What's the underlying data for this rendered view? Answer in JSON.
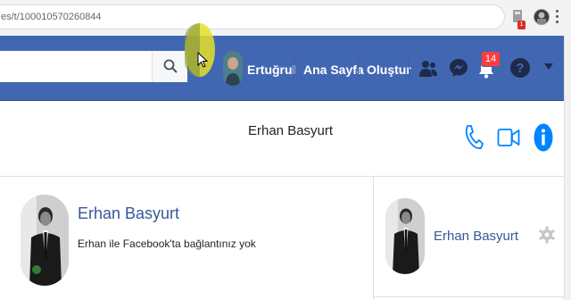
{
  "browser": {
    "url": "es/t/100010570260844",
    "extension_badge": "1"
  },
  "navbar": {
    "user_name": "Ertuğrul",
    "home_label": "Ana Sayfa",
    "create_label": "Oluştur",
    "notification_count": "14"
  },
  "chat": {
    "contact_name": "Erhan Basyurt",
    "conversation_title": "Erhan Basyurt",
    "connection_text": "Erhan ile Facebook'ta bağlantınız yok",
    "side_name": "Erhan Basyurt"
  },
  "colors": {
    "facebook_blue": "#4267b2",
    "messenger_blue": "#0084ff",
    "notification_red": "#fa3e3e",
    "link_blue": "#365899"
  }
}
